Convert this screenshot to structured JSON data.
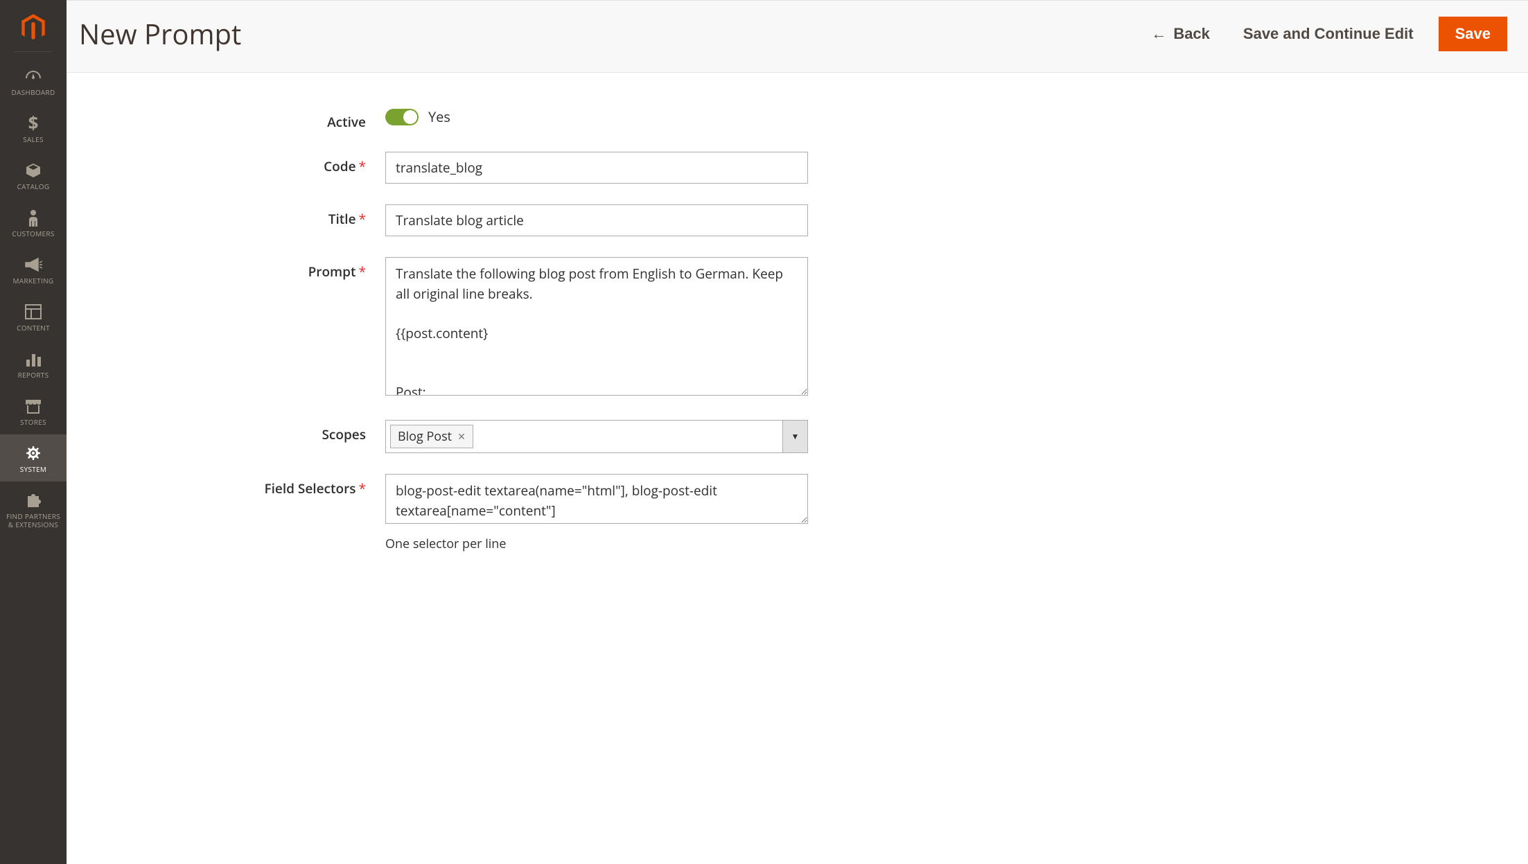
{
  "header": {
    "title": "New Prompt",
    "back_label": "Back",
    "save_continue_label": "Save and Continue Edit",
    "save_label": "Save"
  },
  "sidebar": {
    "items": [
      {
        "id": "dashboard",
        "label": "DASHBOARD"
      },
      {
        "id": "sales",
        "label": "SALES"
      },
      {
        "id": "catalog",
        "label": "CATALOG"
      },
      {
        "id": "customers",
        "label": "CUSTOMERS"
      },
      {
        "id": "marketing",
        "label": "MARKETING"
      },
      {
        "id": "content",
        "label": "CONTENT"
      },
      {
        "id": "reports",
        "label": "REPORTS"
      },
      {
        "id": "stores",
        "label": "STORES"
      },
      {
        "id": "system",
        "label": "SYSTEM",
        "active": true
      },
      {
        "id": "partners",
        "label": "FIND PARTNERS & EXTENSIONS"
      }
    ]
  },
  "form": {
    "active": {
      "label": "Active",
      "value": true,
      "display": "Yes"
    },
    "code": {
      "label": "Code",
      "value": "translate_blog",
      "required": true
    },
    "title": {
      "label": "Title",
      "value": "Translate blog article",
      "required": true
    },
    "prompt": {
      "label": "Prompt",
      "value": "Translate the following blog post from English to German. Keep all original line breaks.\n\n{{post.content}\n\n\nPost:",
      "required": true
    },
    "scopes": {
      "label": "Scopes",
      "tags": [
        "Blog Post"
      ]
    },
    "field_selectors": {
      "label": "Field Selectors",
      "value": "blog-post-edit textarea(name=\"html\"], blog-post-edit textarea[name=\"content\"]",
      "required": true,
      "helper": "One selector per line"
    }
  }
}
